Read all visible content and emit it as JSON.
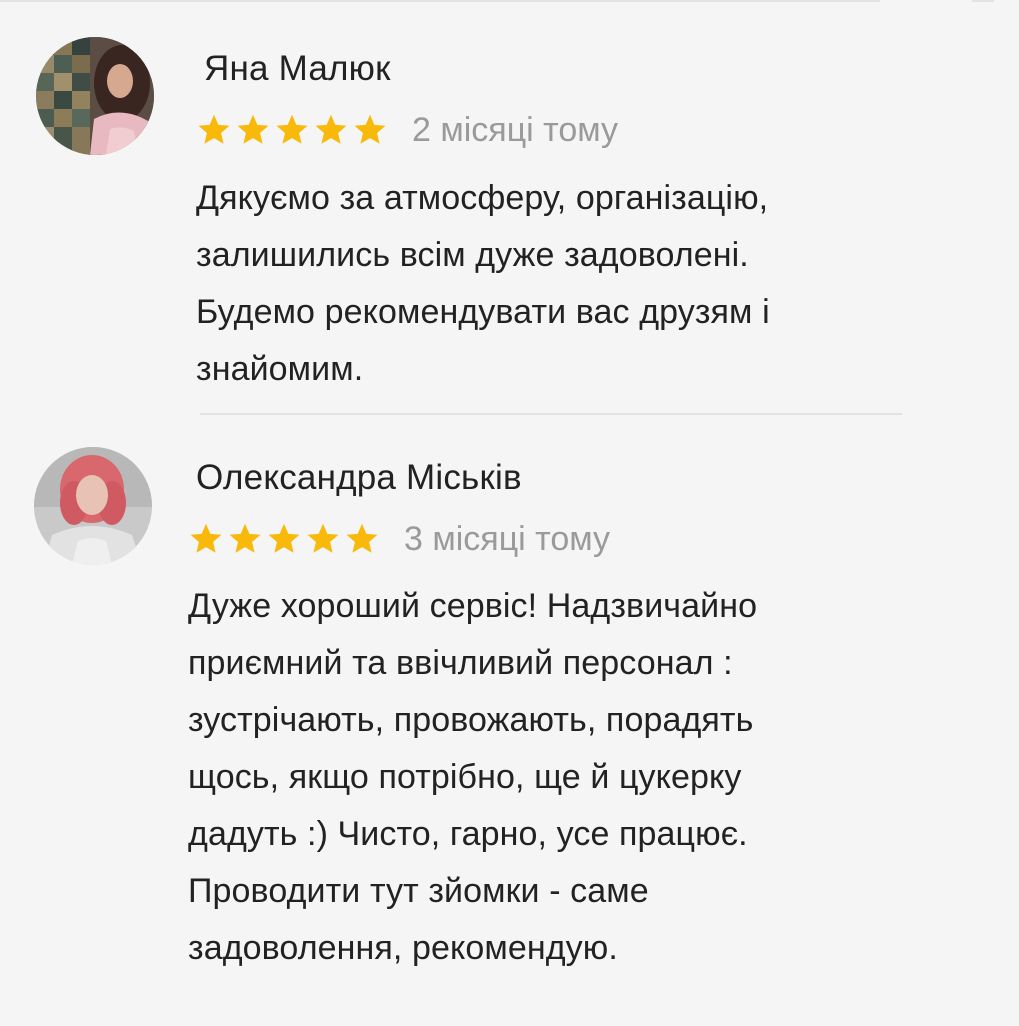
{
  "reviews": [
    {
      "author": "Яна Малюк",
      "rating": 5,
      "max_rating": 5,
      "date": "2 місяці тому",
      "text": "Дякуємо за атмосферу, організацію,\nзалишились всім дуже задоволені.\nБудемо рекомендувати вас друзям і\nзнайомим."
    },
    {
      "author": "Олександра Міськів",
      "rating": 5,
      "max_rating": 5,
      "date": "3 місяці тому",
      "text": "Дуже хороший сервіс! Надзвичайно\nприємний та ввічливий персонал :\nзустрічають, провожають, порадять\nщось, якщо потрібно, ще й цукерку\nдадуть :) Чисто, гарно, усе працює.\nПроводити тут зйомки - саме\nзадоволення, рекомендую."
    }
  ],
  "colors": {
    "background": "#f5f5f5",
    "star": "#f8b90a",
    "date": "#9a9a9a",
    "text": "#222222",
    "divider": "#e2e2e2"
  },
  "icons": {
    "star": "star-icon",
    "avatar": "user-photo"
  }
}
